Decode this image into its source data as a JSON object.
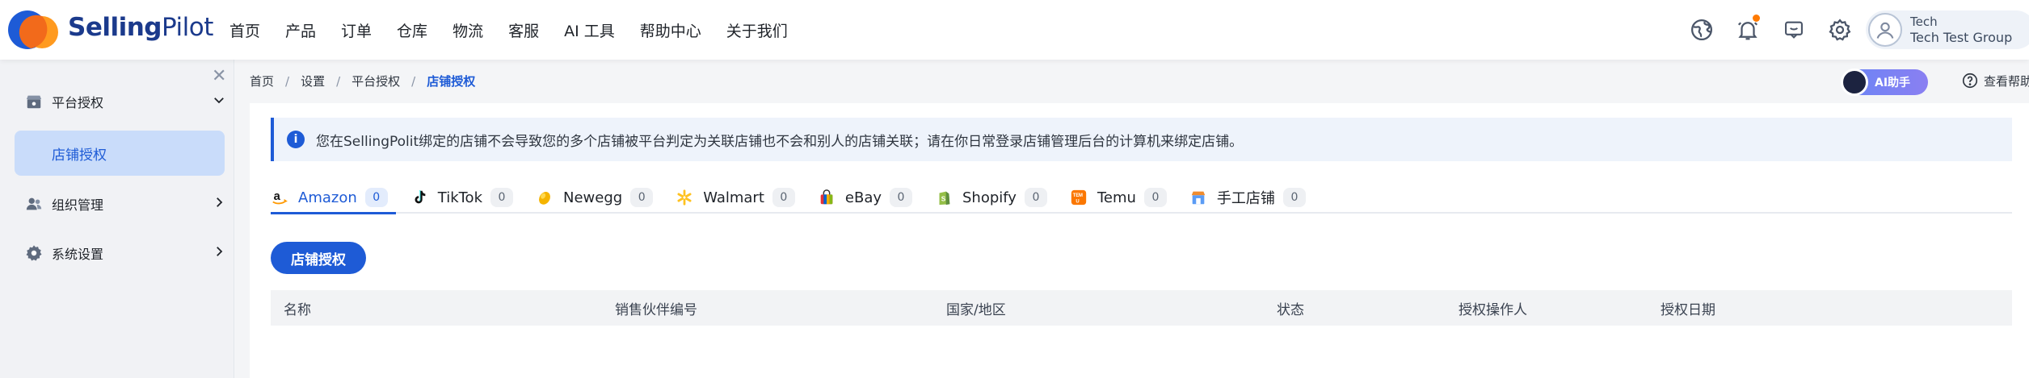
{
  "header": {
    "brand_bold": "Selling",
    "brand_light": "Pilot",
    "nav": [
      "首页",
      "产品",
      "订单",
      "仓库",
      "物流",
      "客服",
      "AI 工具",
      "帮助中心",
      "关于我们"
    ],
    "user": {
      "name": "Tech",
      "group": "Tech Test Group"
    },
    "icons": [
      "globe-icon",
      "bell-icon",
      "chat-icon",
      "gear-icon",
      "user-avatar-icon"
    ],
    "notif_dot_color": "#ff7a00"
  },
  "sidebar": {
    "groups": [
      {
        "label": "平台授权",
        "icon": "store-icon",
        "expanded": true,
        "chevron": "⌄"
      },
      {
        "label": "组织管理",
        "icon": "users-icon",
        "expanded": false,
        "chevron": "›"
      },
      {
        "label": "系统设置",
        "icon": "settings-icon",
        "expanded": false,
        "chevron": "›"
      }
    ],
    "sub_item": "店铺授权"
  },
  "breadcrumb": [
    "首页",
    "设置",
    "平台授权",
    "店铺授权"
  ],
  "ai_assistant": "AI助手",
  "help_link": "查看帮助",
  "notice": "您在SellingPolit绑定的店铺不会导致您的多个店铺被平台判定为关联店铺也不会和别人的店铺关联；请在你日常登录店铺管理后台的计算机来绑定店铺。",
  "tabs": [
    {
      "name": "Amazon",
      "count": "0",
      "active": true,
      "icon": "amazon-icon"
    },
    {
      "name": "TikTok",
      "count": "0",
      "active": false,
      "icon": "tiktok-icon"
    },
    {
      "name": "Newegg",
      "count": "0",
      "active": false,
      "icon": "newegg-icon"
    },
    {
      "name": "Walmart",
      "count": "0",
      "active": false,
      "icon": "walmart-icon"
    },
    {
      "name": "eBay",
      "count": "0",
      "active": false,
      "icon": "ebay-icon"
    },
    {
      "name": "Shopify",
      "count": "0",
      "active": false,
      "icon": "shopify-icon"
    },
    {
      "name": "Temu",
      "count": "0",
      "active": false,
      "icon": "temu-icon"
    },
    {
      "name": "手工店铺",
      "count": "0",
      "active": false,
      "icon": "manual-store-icon"
    }
  ],
  "primary_button": "店铺授权",
  "table": {
    "columns": [
      "名称",
      "销售伙伴编号",
      "国家/地区",
      "状态",
      "授权操作人",
      "授权日期"
    ]
  },
  "colors": {
    "accent": "#1e5bd6",
    "brand": "#1b3a8c"
  }
}
